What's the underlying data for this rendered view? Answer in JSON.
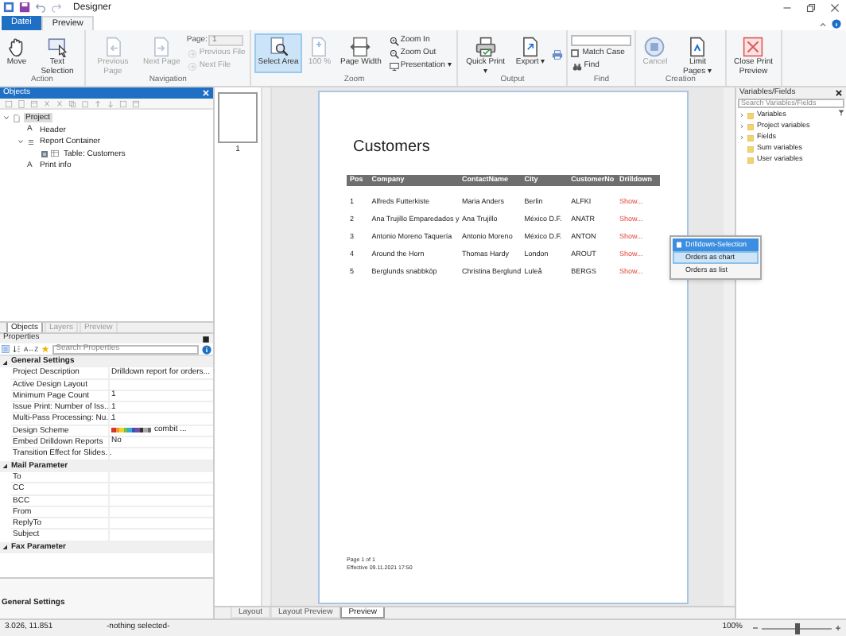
{
  "window": {
    "title": "Designer"
  },
  "ribbon_tabs": [
    {
      "label": "Datei",
      "selected": false,
      "kind": "file"
    },
    {
      "label": "Preview",
      "selected": true,
      "kind": "tab"
    }
  ],
  "ribbon_groups": [
    {
      "label": "Action",
      "items": [
        {
          "kind": "large",
          "label": "Move",
          "disabled": false,
          "selected": false
        },
        {
          "kind": "large",
          "label": "Text Selection",
          "disabled": false,
          "selected": false
        }
      ]
    },
    {
      "label": "Navigation",
      "items": [
        {
          "kind": "large",
          "label": "Previous Page",
          "disabled": true,
          "selected": false
        },
        {
          "kind": "large",
          "label": "Next Page",
          "disabled": true,
          "selected": false
        },
        {
          "kind": "field",
          "label": "Page:",
          "value": "1",
          "disabled": true
        },
        {
          "kind": "small",
          "label": "Previous File",
          "disabled": true
        },
        {
          "kind": "small",
          "label": "Next File",
          "disabled": true
        }
      ]
    },
    {
      "label": "Zoom",
      "items": [
        {
          "kind": "large",
          "label": "Select Area",
          "disabled": false,
          "selected": true
        },
        {
          "kind": "large",
          "label": "100 %",
          "disabled": true,
          "selected": false
        },
        {
          "kind": "large",
          "label": "Page Width",
          "disabled": false,
          "selected": false
        },
        {
          "kind": "small",
          "label": "Zoom In",
          "disabled": false
        },
        {
          "kind": "small",
          "label": "Zoom Out",
          "disabled": false
        },
        {
          "kind": "small",
          "label": "Presentation ▾",
          "disabled": false
        }
      ]
    },
    {
      "label": "Output",
      "items": [
        {
          "kind": "large",
          "label": "Quick Print ▾",
          "disabled": false,
          "selected": false
        },
        {
          "kind": "large",
          "label": "Export ▾",
          "disabled": false,
          "selected": false
        },
        {
          "kind": "icon",
          "disabled": false
        }
      ]
    },
    {
      "label": "Find",
      "items": [
        {
          "kind": "field",
          "disabled": false
        },
        {
          "kind": "checkbox",
          "label": "Match Case",
          "checked": false,
          "disabled": false
        },
        {
          "kind": "small",
          "label": "Find",
          "disabled": false
        }
      ]
    },
    {
      "label": "Creation",
      "items": [
        {
          "kind": "large",
          "label": "Cancel",
          "disabled": true,
          "selected": false
        },
        {
          "kind": "large",
          "label": "Limit Pages ▾",
          "disabled": false,
          "selected": false
        }
      ]
    },
    {
      "items": [
        {
          "kind": "large",
          "label": "Close Print Preview",
          "disabled": false,
          "selected": false
        }
      ]
    }
  ],
  "objects_panel": {
    "title": "Objects",
    "tree": [
      {
        "label": "Project",
        "kind": "page",
        "selected": true,
        "expanded": true,
        "children": [
          {
            "label": "Header",
            "kind": "glyph",
            "glyph": "A",
            "selected": false
          },
          {
            "label": "Report Container",
            "kind": "container",
            "selected": false,
            "expanded": true,
            "children": [
              {
                "label": "Table: Customers",
                "kind": "table",
                "checked": true,
                "selected": false
              }
            ]
          },
          {
            "label": "Print info",
            "kind": "glyph",
            "glyph": "A",
            "selected": false
          }
        ]
      }
    ],
    "tabs": [
      {
        "label": "Objects",
        "selected": true
      },
      {
        "label": "Layers",
        "selected": false
      },
      {
        "label": "Preview",
        "selected": false
      }
    ]
  },
  "properties_panel": {
    "title": "Properties",
    "search": {
      "placeholder": "Search Properties"
    },
    "sort_label": "A↔Z",
    "sections": [
      {
        "title": "General Settings",
        "expanded": true,
        "rows": [
          {
            "name": "Project Description",
            "value": "Drilldown report for orders..."
          },
          {
            "name": "Active Design Layout"
          },
          {
            "name": "Minimum Page Count",
            "value": "1"
          },
          {
            "name": "Issue Print: Number of Iss...",
            "value": "1"
          },
          {
            "name": "Multi-Pass Processing: Nu...",
            "value": "1"
          },
          {
            "name": "Design Scheme",
            "value": "combit ...",
            "kind": "scheme"
          },
          {
            "name": "Embed Drilldown Reports",
            "value": "No"
          },
          {
            "name": "Transition Effect for Slides..."
          }
        ]
      },
      {
        "title": "Mail Parameter",
        "expanded": true,
        "rows": [
          {
            "name": "To"
          },
          {
            "name": "CC"
          },
          {
            "name": "BCC"
          },
          {
            "name": "From"
          },
          {
            "name": "ReplyTo"
          },
          {
            "name": "Subject"
          }
        ]
      },
      {
        "title": "Fax Parameter",
        "expanded": true
      }
    ],
    "description": "General Settings"
  },
  "thumbnails": [
    {
      "label": "1",
      "selected": true
    }
  ],
  "document": {
    "title": "Customers",
    "columns": [
      "Pos",
      "Company",
      "ContactName",
      "City",
      "CustomerNo",
      "Drilldown"
    ],
    "rows": [
      [
        "1",
        "Alfreds Futterkiste",
        "Maria Anders",
        "Berlin",
        "ALFKI",
        "Show..."
      ],
      [
        "2",
        "Ana Trujillo Emparedados y",
        "Ana Trujillo",
        "México D.F.",
        "ANATR",
        "Show..."
      ],
      [
        "3",
        "Antonio Moreno Taquería",
        "Antonio Moreno",
        "México D.F.",
        "ANTON",
        "Show..."
      ],
      [
        "4",
        "Around the Horn",
        "Thomas Hardy",
        "London",
        "AROUT",
        "Show..."
      ],
      [
        "5",
        "Berglunds snabbköp",
        "Christina Berglund",
        "Luleå",
        "BERGS",
        "Show..."
      ]
    ],
    "footer": [
      "Page 1 of 1",
      "Effective 09.11.2021 17:50"
    ]
  },
  "context_menu": {
    "items": [
      {
        "label": "Drilldown-Selection",
        "kind": "header"
      },
      {
        "label": "Orders as chart",
        "kind": "item",
        "selected": true
      },
      {
        "label": "Orders as list",
        "kind": "item",
        "selected": false
      }
    ]
  },
  "variables_panel": {
    "title": "Variables/Fields",
    "search": {
      "placeholder": "Search Variables/Fields"
    },
    "items": [
      {
        "label": "Variables",
        "expanded": false
      },
      {
        "label": "Project variables",
        "expanded": false
      },
      {
        "label": "Fields",
        "expanded": false
      },
      {
        "label": "Sum variables"
      },
      {
        "label": "User variables"
      }
    ]
  },
  "bottom_tabs": [
    {
      "label": "Layout",
      "selected": false
    },
    {
      "label": "Layout Preview",
      "selected": false
    },
    {
      "label": "Preview",
      "selected": true
    }
  ],
  "status_bar": {
    "coordinates": "3.026, 11.851",
    "selection": "-nothing selected-",
    "zoom": "100%",
    "zoom_slider": {
      "level": 0.5
    }
  }
}
